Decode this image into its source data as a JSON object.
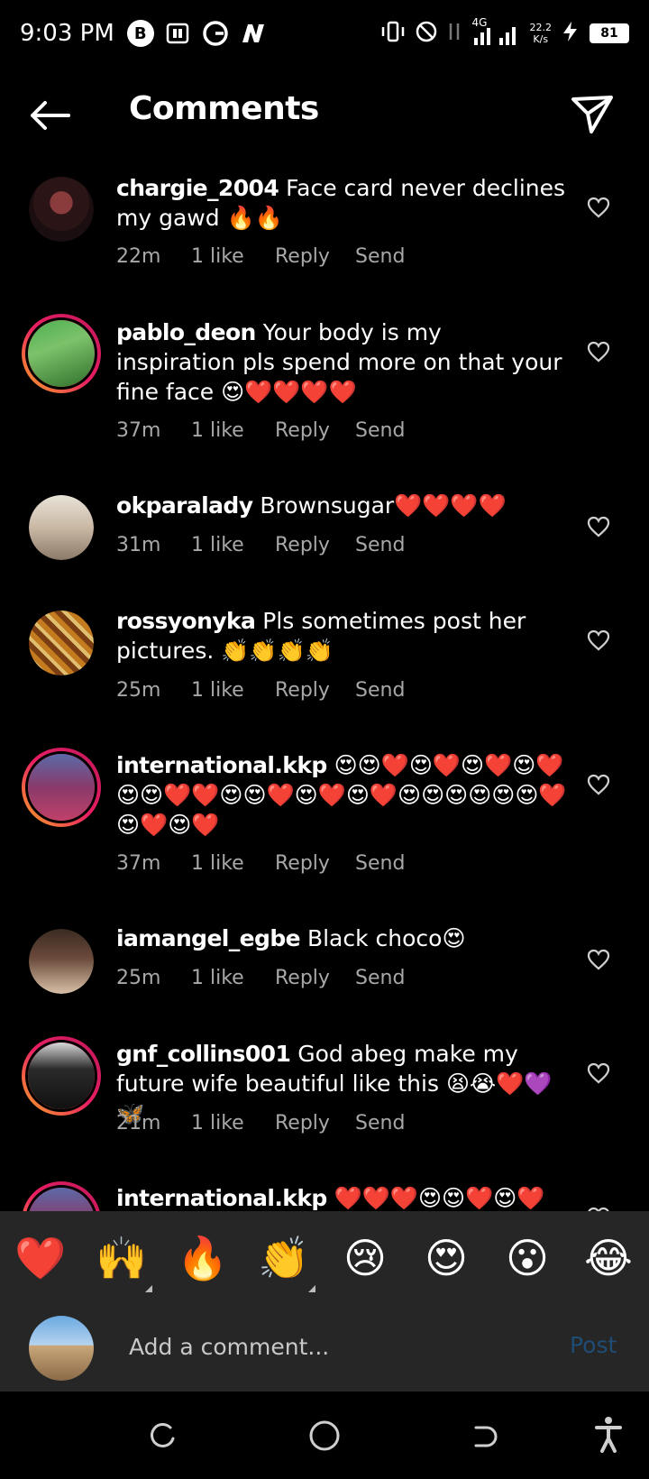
{
  "status_bar": {
    "time": "9:03 PM",
    "network_type": "4G",
    "speed_value": "22.2",
    "speed_unit": "K/s",
    "battery": "81"
  },
  "header": {
    "title": "Comments"
  },
  "comments": [
    {
      "username": "chargie_2004",
      "text": "Face card never declines my gawd 🔥🔥",
      "time": "22m",
      "likes": "1 like",
      "reply": "Reply",
      "send": "Send"
    },
    {
      "username": "pablo_deon",
      "text": "Your body is my inspiration pls spend more on that your fine face 😍❤️❤️❤️❤️",
      "time": "37m",
      "likes": "1 like",
      "reply": "Reply",
      "send": "Send"
    },
    {
      "username": "okparalady",
      "text": "Brownsugar❤️❤️❤️❤️",
      "time": "31m",
      "likes": "1 like",
      "reply": "Reply",
      "send": "Send"
    },
    {
      "username": "rossyonyka",
      "text": "Pls sometimes  post her pictures. 👏👏👏👏",
      "time": "25m",
      "likes": "1 like",
      "reply": "Reply",
      "send": "Send"
    },
    {
      "username": "international.kkp",
      "text": "😍😍❤️😍❤️😍❤️😍❤️😍😍❤️❤️😍😍❤️😍❤️😍❤️😍😍😍😍😍😍❤️😍❤️😍❤️",
      "time": "37m",
      "likes": "1 like",
      "reply": "Reply",
      "send": "Send"
    },
    {
      "username": "iamangel_egbe",
      "text": "Black choco😍",
      "time": "25m",
      "likes": "1 like",
      "reply": "Reply",
      "send": "Send"
    },
    {
      "username": "gnf_collins001",
      "text": "God abeg make my future wife beautiful like this 😫😭❤️💜🦋",
      "time": "21m",
      "likes": "1 like",
      "reply": "Reply",
      "send": "Send"
    },
    {
      "username": "international.kkp",
      "text": "❤️❤️❤️😍😍❤️😍❤️"
    }
  ],
  "emoji_bar": [
    "❤️",
    "🙌",
    "🔥",
    "👏",
    "😢",
    "😍",
    "😮",
    "😂"
  ],
  "composer": {
    "placeholder": "Add a comment...",
    "post_label": "Post"
  },
  "colors": {
    "background": "#000000",
    "panel": "#262626",
    "meta_text": "#a8a8a8",
    "post_disabled": "#1f4c74",
    "story_ring": "#e91e63"
  }
}
